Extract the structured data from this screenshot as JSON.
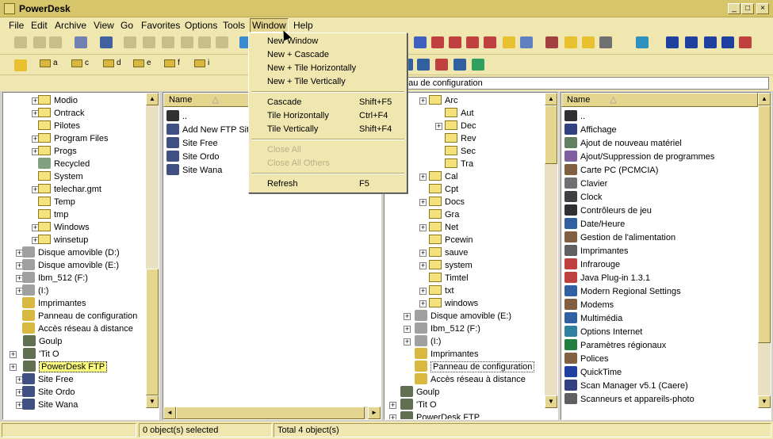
{
  "window": {
    "title": "PowerDesk"
  },
  "menu": [
    "File",
    "Edit",
    "Archive",
    "View",
    "Go",
    "Favorites",
    "Options",
    "Tools",
    "Window",
    "Help"
  ],
  "drives": [
    "a",
    "c",
    "d",
    "e",
    "f",
    "i"
  ],
  "address": "eau de configuration",
  "window_menu": [
    {
      "label": "New Window",
      "shortcut": ""
    },
    {
      "label": "New + Cascade",
      "shortcut": ""
    },
    {
      "label": "New + Tile Horizontally",
      "shortcut": ""
    },
    {
      "label": "New + Tile Vertically",
      "shortcut": ""
    },
    {
      "label": "Cascade",
      "shortcut": "Shift+F5"
    },
    {
      "label": "Tile Horizontally",
      "shortcut": "Ctrl+F4"
    },
    {
      "label": "Tile Vertically",
      "shortcut": "Shift+F4"
    },
    {
      "label": "Close All",
      "shortcut": ""
    },
    {
      "label": "Close All Others",
      "shortcut": ""
    },
    {
      "label": "Refresh",
      "shortcut": "F5"
    }
  ],
  "left_tree": [
    "Modio",
    "Ontrack",
    "Pilotes",
    "Program Files",
    "Progs",
    "Recycled",
    "System",
    "telechar.gmt",
    "Temp",
    "tmp",
    "Windows",
    "winsetup",
    "Disque amovible (D:)",
    "Disque amovible (E:)",
    "Ibm_512 (F:)",
    "(I:)",
    "Imprimantes",
    "Panneau de configuration",
    "Accès réseau à distance",
    "Goulp",
    "'Tit O",
    "PowerDesk FTP",
    "Site Free",
    "Site Ordo",
    "Site Wana"
  ],
  "left_list": {
    "header": "Name",
    "items": [
      "..",
      "Add New FTP Site...",
      "Site Free",
      "Site Ordo",
      "Site Wana"
    ]
  },
  "right_tree": [
    "Arc",
    "Aut",
    "Dec",
    "Rev",
    "Sec",
    "Tra",
    "Cal",
    "Cpt",
    "Docs",
    "Gra",
    "Net",
    "Pcewin",
    "sauve",
    "system",
    "Timtel",
    "txt",
    "windows",
    "Disque amovible (E:)",
    "Ibm_512 (F:)",
    "(I:)",
    "Imprimantes",
    "Panneau de configuration",
    "Accès réseau à distance",
    "Goulp",
    "'Tit O",
    "PowerDesk FTP"
  ],
  "right_list": {
    "header": "Name",
    "items": [
      "..",
      "Affichage",
      "Ajout de nouveau matériel",
      "Ajout/Suppression de programmes",
      "Carte PC (PCMCIA)",
      "Clavier",
      "Clock",
      "Contrôleurs de jeu",
      "Date/Heure",
      "Gestion de l'alimentation",
      "Imprimantes",
      "Infrarouge",
      "Java Plug-in 1.3.1",
      "Modern Regional Settings",
      "Modems",
      "Multimédia",
      "Options Internet",
      "Paramètres régionaux",
      "Polices",
      "QuickTime",
      "Scan Manager v5.1 (Caere)",
      "Scanneurs et appareils-photo"
    ]
  },
  "status": {
    "selected": "0 object(s) selected",
    "total": "Total 4 object(s)"
  }
}
